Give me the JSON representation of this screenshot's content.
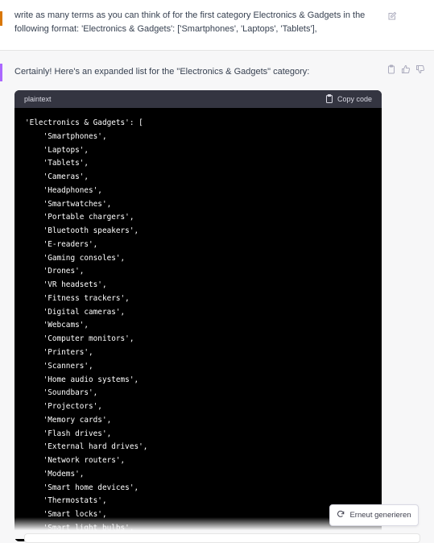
{
  "user_message": {
    "text": "write as many terms as you can think of for the first category Electronics & Gadgets in the following format: 'Electronics & Gadgets': ['Smartphones', 'Laptops', 'Tablets'],"
  },
  "assistant_message": {
    "text": "Certainly! Here's an expanded list for the \"Electronics & Gadgets\" category:",
    "code": {
      "language": "plaintext",
      "copy_label": "Copy code",
      "lines": [
        "'Electronics & Gadgets': [",
        "    'Smartphones',",
        "    'Laptops',",
        "    'Tablets',",
        "    'Cameras',",
        "    'Headphones',",
        "    'Smartwatches',",
        "    'Portable chargers',",
        "    'Bluetooth speakers',",
        "    'E-readers',",
        "    'Gaming consoles',",
        "    'Drones',",
        "    'VR headsets',",
        "    'Fitness trackers',",
        "    'Digital cameras',",
        "    'Webcams',",
        "    'Computer monitors',",
        "    'Printers',",
        "    'Scanners',",
        "    'Home audio systems',",
        "    'Soundbars',",
        "    'Projectors',",
        "    'Memory cards',",
        "    'Flash drives',",
        "    'External hard drives',",
        "    'Network routers',",
        "    'Modems',",
        "    'Smart home devices',",
        "    'Thermostats',",
        "    'Smart locks',",
        "    'Smart light bulbs',"
      ]
    }
  },
  "regenerate_label": "Erneut generieren",
  "icons": {
    "edit": "edit-icon",
    "clipboard": "clipboard-icon",
    "thumbs_up": "thumbs-up-icon",
    "thumbs_down": "thumbs-down-icon",
    "regenerate": "refresh-icon"
  },
  "colors": {
    "user_accent": "#d97706",
    "assistant_accent": "#ab68ff",
    "code_background": "#000000",
    "code_header": "#343541"
  }
}
